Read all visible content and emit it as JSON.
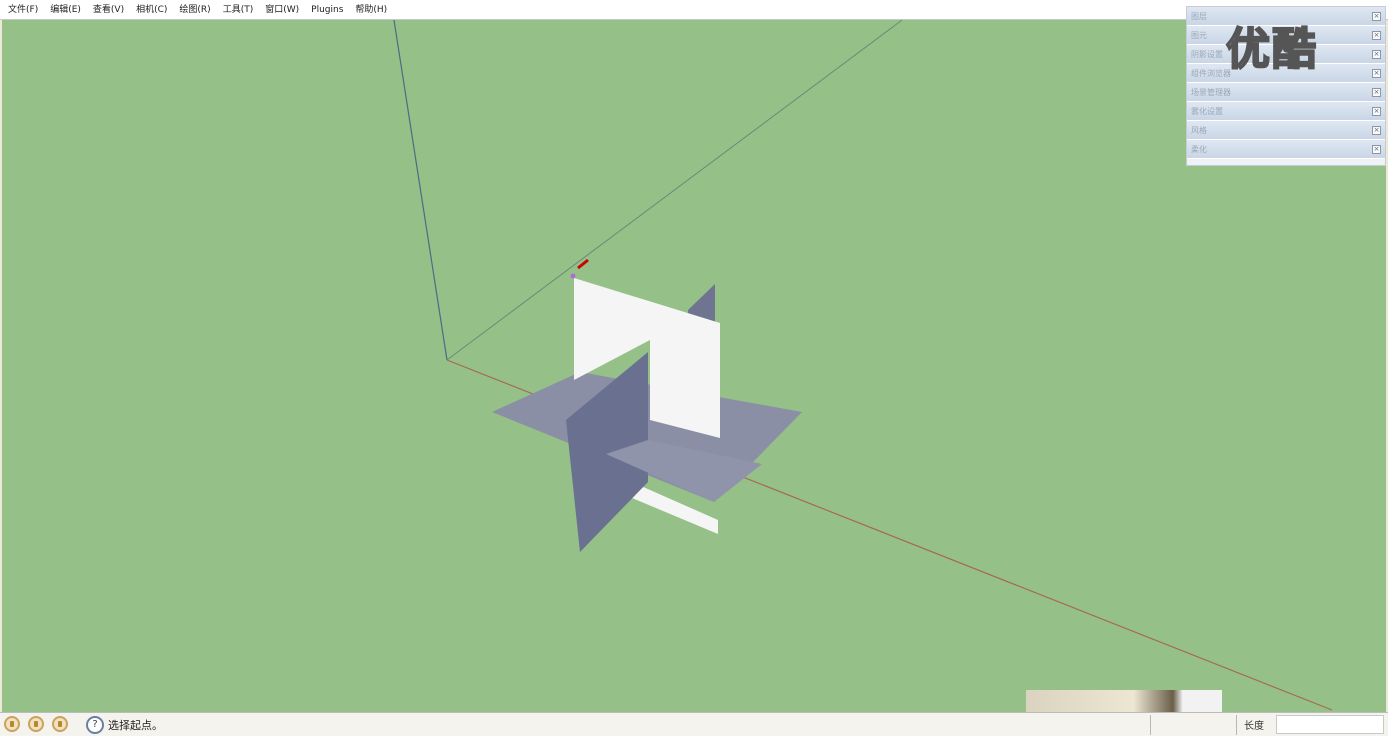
{
  "menu": [
    "文件(F)",
    "编辑(E)",
    "查看(V)",
    "相机(C)",
    "绘图(R)",
    "工具(T)",
    "窗口(W)",
    "Plugins",
    "帮助(H)"
  ],
  "trays": [
    "图层",
    "图元",
    "阴影设置",
    "组件浏览器",
    "场景管理器",
    "雾化设置",
    "风格",
    "柔化"
  ],
  "watermark": "优酷",
  "status": {
    "prompt": "选择起点。",
    "measure_label": "长度",
    "measure_value": "",
    "help_icon_glyph": "?"
  },
  "colors": {
    "viewport_bg": "#95c088",
    "face_front": "#f5f5f5",
    "face_back": "#8a8fa6",
    "axis_red": "#a66b4f",
    "axis_green": "#5d8a72",
    "axis_blue": "#4d6a86"
  }
}
